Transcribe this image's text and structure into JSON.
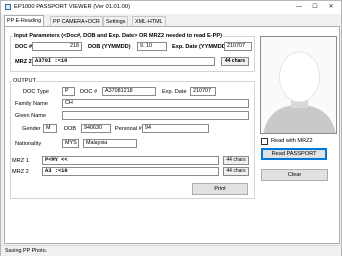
{
  "window": {
    "title": "EP1000 PASSPORT VIEWER (Ver 01.01.00)",
    "min_glyph": "—",
    "max_glyph": "☐",
    "close_glyph": "✕"
  },
  "tabs": [
    {
      "label": "PP E-Reading"
    },
    {
      "label": "PP CAMERA+OCR"
    },
    {
      "label": "Settings"
    },
    {
      "label": "XML-HTML"
    }
  ],
  "input": {
    "title": "Input Parameters (<Doc#, DOB and Exp. Date> OR MRZ2 needed to read E-PP)",
    "doc_label": "DOC #",
    "doc_value": "218",
    "dob_label": "DOB (YYMMDD)",
    "dob_value": "9.   10",
    "exp_label": "Exp. Date (YYMMDD)",
    "exp_value": "210707",
    "mrz2_label": "MRZ 2",
    "mrz2_value": "A370I                                    :<10",
    "mrz2_chars": "44 chars"
  },
  "output": {
    "title": "OUTPUT",
    "doc_type_label": "DOC Type",
    "doc_type_value": "P",
    "doc_label": "DOC #",
    "doc_value": "A37081218",
    "exp_label": "Exp. Date",
    "exp_value": "210707",
    "family_label": "Family Name",
    "family_value": "CH",
    "given_label": "Given Name",
    "given_value": "",
    "gender_label": "Gender",
    "gender_value": "M",
    "dob_label": "DOB",
    "dob_value": "940630",
    "personal_label": "Personal #",
    "personal_value": "94",
    "nationality_label": "Nationality",
    "nationality_code": "MYS",
    "nationality_name": "Malaysia",
    "mrz1_label": "MRZ 1",
    "mrz1_value": "P<MY                                        <<",
    "mrz1_chars": "44 chars",
    "mrz2_label": "MRZ 2",
    "mrz2_value": "A3                                         :<10",
    "mrz2_chars": "44 chars",
    "print_label": "Print"
  },
  "side": {
    "read_with_mrz2_label": "Read with MRZ2",
    "read_passport_label": "Read PASSPORT",
    "clear_label": "Clear"
  },
  "status": {
    "text": "Saving PP Photo."
  },
  "colors": {
    "focus_border": "#0078d7",
    "window_bg": "#f0f0f0"
  }
}
